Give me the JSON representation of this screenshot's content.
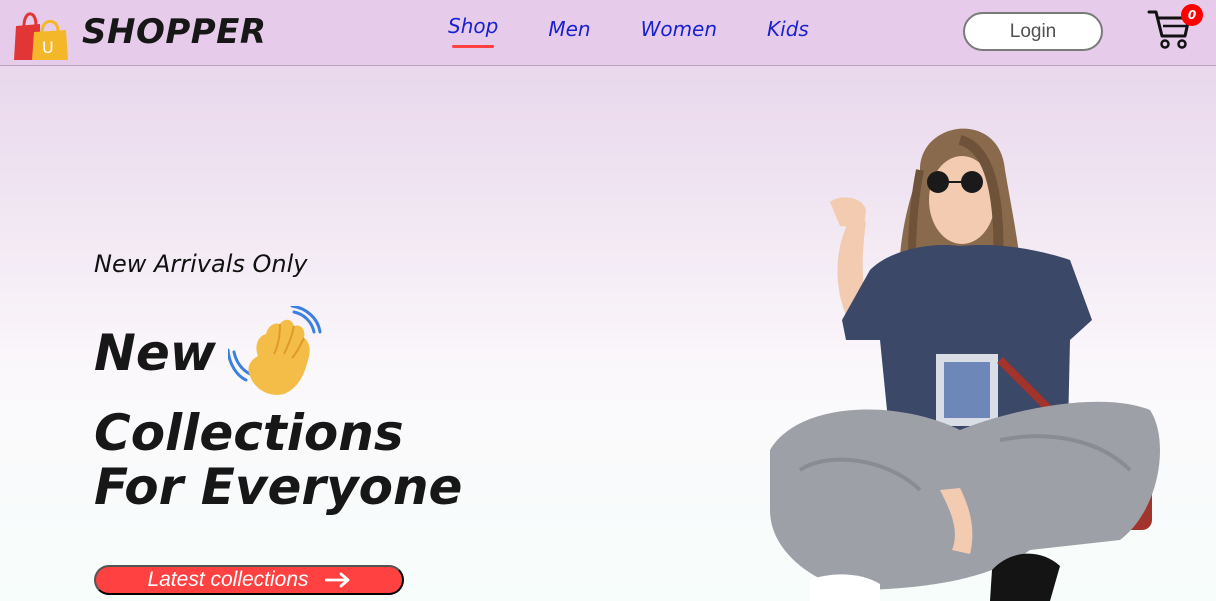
{
  "navbar": {
    "brand": "SHOPPER",
    "logo_icon": "shopping-bag-icon",
    "logo_letter": "U",
    "menu": [
      {
        "label": "Shop",
        "active": true
      },
      {
        "label": "Men",
        "active": false
      },
      {
        "label": "Women",
        "active": false
      },
      {
        "label": "Kids",
        "active": false
      }
    ],
    "login_label": "Login",
    "cart_icon": "cart-icon",
    "cart_count": "0"
  },
  "hero": {
    "tagline": "New Arrivals Only",
    "headline_line1": "New",
    "headline_line2": "Collections",
    "headline_line3": "For Everyone",
    "wave_icon": "waving-hand-icon",
    "cta_label": "Latest collections",
    "cta_icon": "arrow-right-icon",
    "image_subject": "hero-model-image"
  },
  "colors": {
    "accent": "#ff4141",
    "nav_link": "#1a22cf",
    "cart_badge": "#ff0000",
    "background_top": "#e6ccea",
    "background_bottom": "#f7fdfb"
  }
}
